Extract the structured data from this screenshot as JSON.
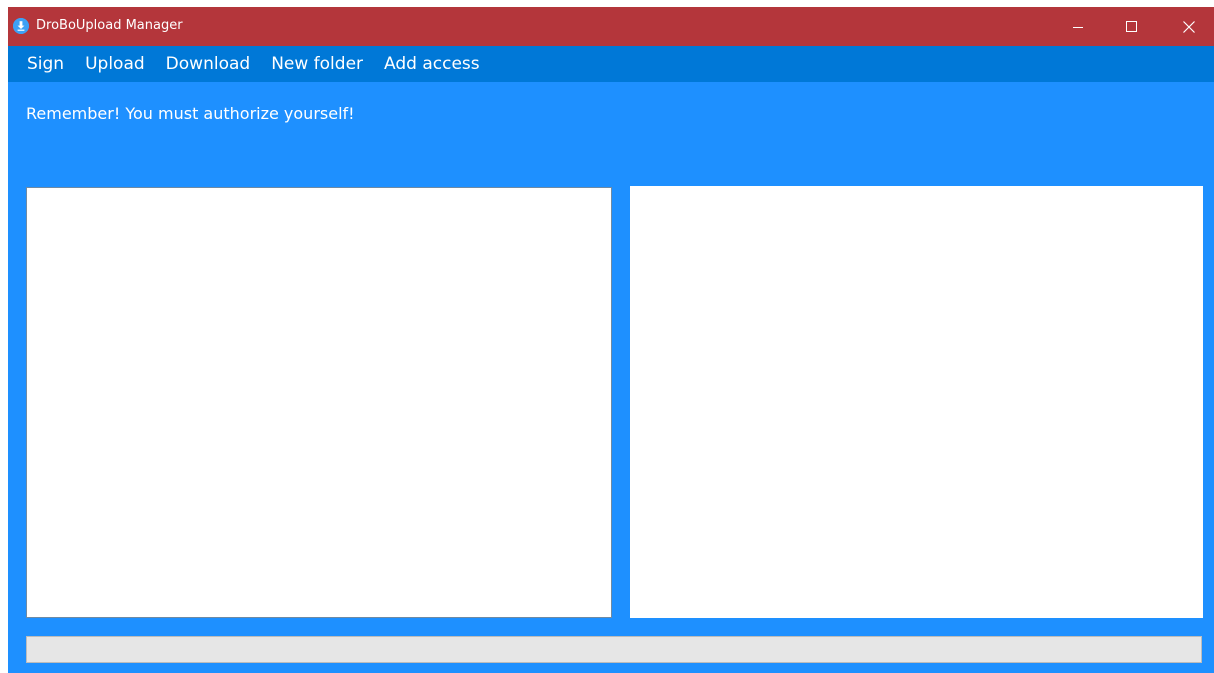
{
  "window": {
    "title": "DroBoUpload Manager",
    "icon": "download-circle-icon",
    "controls": {
      "minimize_icon": "minimize-icon",
      "maximize_icon": "maximize-icon",
      "close_icon": "close-icon"
    }
  },
  "menu": {
    "items": [
      {
        "label": "Sign"
      },
      {
        "label": "Upload"
      },
      {
        "label": "Download"
      },
      {
        "label": "New folder"
      },
      {
        "label": "Add access"
      }
    ]
  },
  "main": {
    "message": "Remember! You must authorize yourself!"
  },
  "progress": {
    "value": 0
  },
  "colors": {
    "titlebar": "#b4363b",
    "menubar": "#0078d7",
    "background": "#1e90ff",
    "panel": "#ffffff",
    "progress_track": "#e6e6e6"
  }
}
